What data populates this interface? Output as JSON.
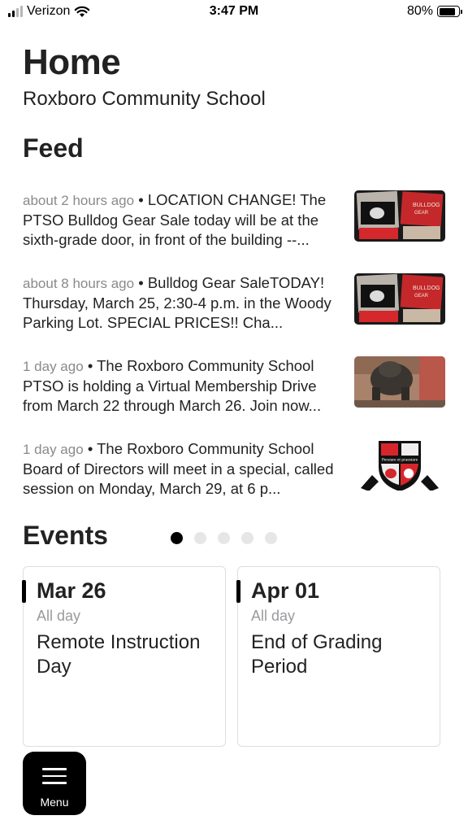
{
  "status_bar": {
    "carrier": "Verizon",
    "time": "3:47 PM",
    "battery_label": "80%",
    "battery_level": 0.8,
    "icons": [
      "signal-bars-icon",
      "wifi-icon",
      "battery-icon"
    ]
  },
  "header": {
    "title": "Home",
    "subtitle": "Roxboro Community School"
  },
  "feed": {
    "section_title": "Feed",
    "items": [
      {
        "time": "about 2 hours ago",
        "text": " • LOCATION CHANGE! The PTSO Bulldog Gear Sale today will be at the sixth-grade door, in front of the building --...",
        "thumb": "bulldog-gear-photo"
      },
      {
        "time": "about 8 hours ago",
        "text": " • Bulldog Gear SaleTODAY! Thursday, March 25, 2:30-4 p.m. in the Woody Parking Lot. SPECIAL PRICES!! Cha...",
        "thumb": "bulldog-gear-photo"
      },
      {
        "time": "1 day ago",
        "text": " • The Roxboro Community School PTSO is holding a Virtual Membership Drive from March 22 through March 26. Join now...",
        "thumb": "bulldog-statue-photo"
      },
      {
        "time": "1 day ago",
        "text": " • The Roxboro Community School Board of Directors will meet in a special, called session on Monday, March 29, at 6 p...",
        "thumb": "school-crest-logo"
      }
    ]
  },
  "events": {
    "section_title": "Events",
    "page_count": 5,
    "active_page": 1,
    "cards": [
      {
        "date": "Mar 26",
        "time": "All day",
        "title": "Remote Instruction Day"
      },
      {
        "date": "Apr 01",
        "time": "All day",
        "title": "End of Grading Period"
      }
    ]
  },
  "menu": {
    "label": "Menu",
    "icon": "hamburger-icon"
  },
  "colors": {
    "accent": "#000000",
    "muted_text": "#8a8a8e",
    "brand_red": "#d6262b"
  }
}
